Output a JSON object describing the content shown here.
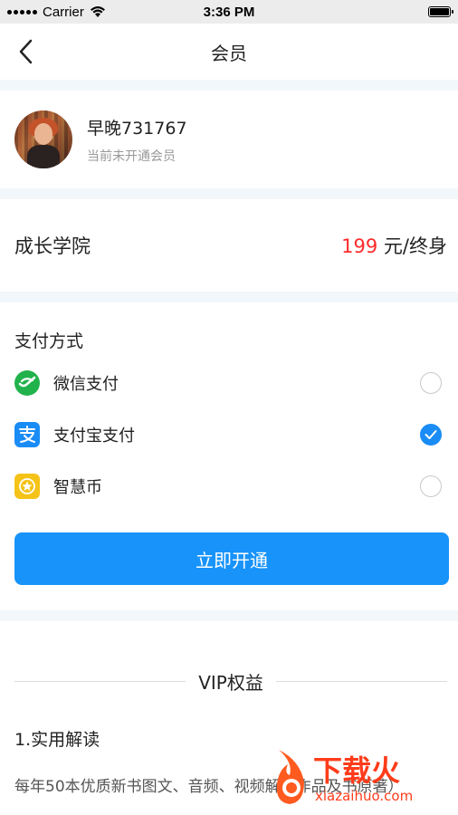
{
  "status_bar": {
    "carrier": "Carrier",
    "time": "3:36 PM"
  },
  "nav": {
    "title": "会员",
    "back_icon": "chevron-left-icon"
  },
  "profile": {
    "username": "早晚731767",
    "status": "当前未开通会员"
  },
  "product": {
    "name": "成长学院",
    "price_value": "199",
    "price_unit": " 元/终身",
    "price_color": "#ff2a2a"
  },
  "payment": {
    "title": "支付方式",
    "options": [
      {
        "label": "微信支付",
        "icon": "wechat-icon",
        "color": "#22b24c",
        "checked": false
      },
      {
        "label": "支付宝支付",
        "icon": "alipay-icon",
        "color": "#1a8cf5",
        "checked": true
      },
      {
        "label": "智慧币",
        "icon": "coin-icon",
        "color": "#f5c318",
        "checked": false
      }
    ],
    "submit_label": "立即开通",
    "accent_color": "#1893fa"
  },
  "vip": {
    "title": "VIP权益",
    "benefit_1_title": "1.实用解读",
    "benefit_1_desc": "每年50本优质新书图文、音频、视频解读作品及书原著）"
  },
  "watermark": {
    "brand": "下载火",
    "domain": "xiazaihuo.com"
  }
}
